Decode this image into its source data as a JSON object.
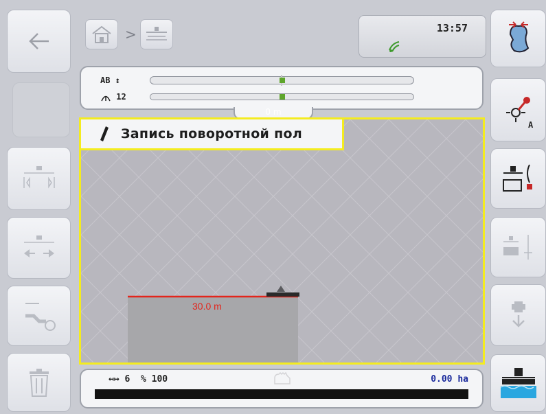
{
  "header": {
    "clock": "13:57",
    "breadcrumb_separator": ">",
    "breadcrumb": [
      {
        "icon": "home-icon"
      },
      {
        "icon": "field-tractor-icon"
      }
    ],
    "status_icon": "gps-signal-icon"
  },
  "lightbar": {
    "mode_label": "AB ↕",
    "track_label": "12",
    "track_icon": "track-number-icon",
    "deviation": "0 m",
    "marker_color": "#5ea52b"
  },
  "map": {
    "banner_text": "Запись поворотной пол",
    "banner_icon": "pencil-icon",
    "line_label": "30.0 m",
    "line_color": "#e3251c",
    "border_color": "#f4ec1f"
  },
  "bottombar": {
    "width_value": "6",
    "percent_value": "100",
    "area": "0.00 ha"
  },
  "left_buttons": [
    {
      "icon": "back-arrow-icon",
      "enabled": true
    },
    {
      "icon": "",
      "enabled": false
    },
    {
      "icon": "working-width-icon",
      "enabled": false
    },
    {
      "icon": "shift-left-right-icon",
      "enabled": false
    },
    {
      "icon": "turn-rotate-icon",
      "enabled": false
    },
    {
      "icon": "trash-icon",
      "enabled": false
    }
  ],
  "right_buttons": [
    {
      "icon": "field-boundary-icon",
      "enabled": true
    },
    {
      "icon": "set-point-a-icon",
      "enabled": true
    },
    {
      "icon": "headland-record-icon",
      "enabled": true
    },
    {
      "icon": "headland-offset-icon",
      "enabled": false
    },
    {
      "icon": "tractor-move-down-icon",
      "enabled": false
    },
    {
      "icon": "implement-water-icon",
      "enabled": true
    }
  ]
}
